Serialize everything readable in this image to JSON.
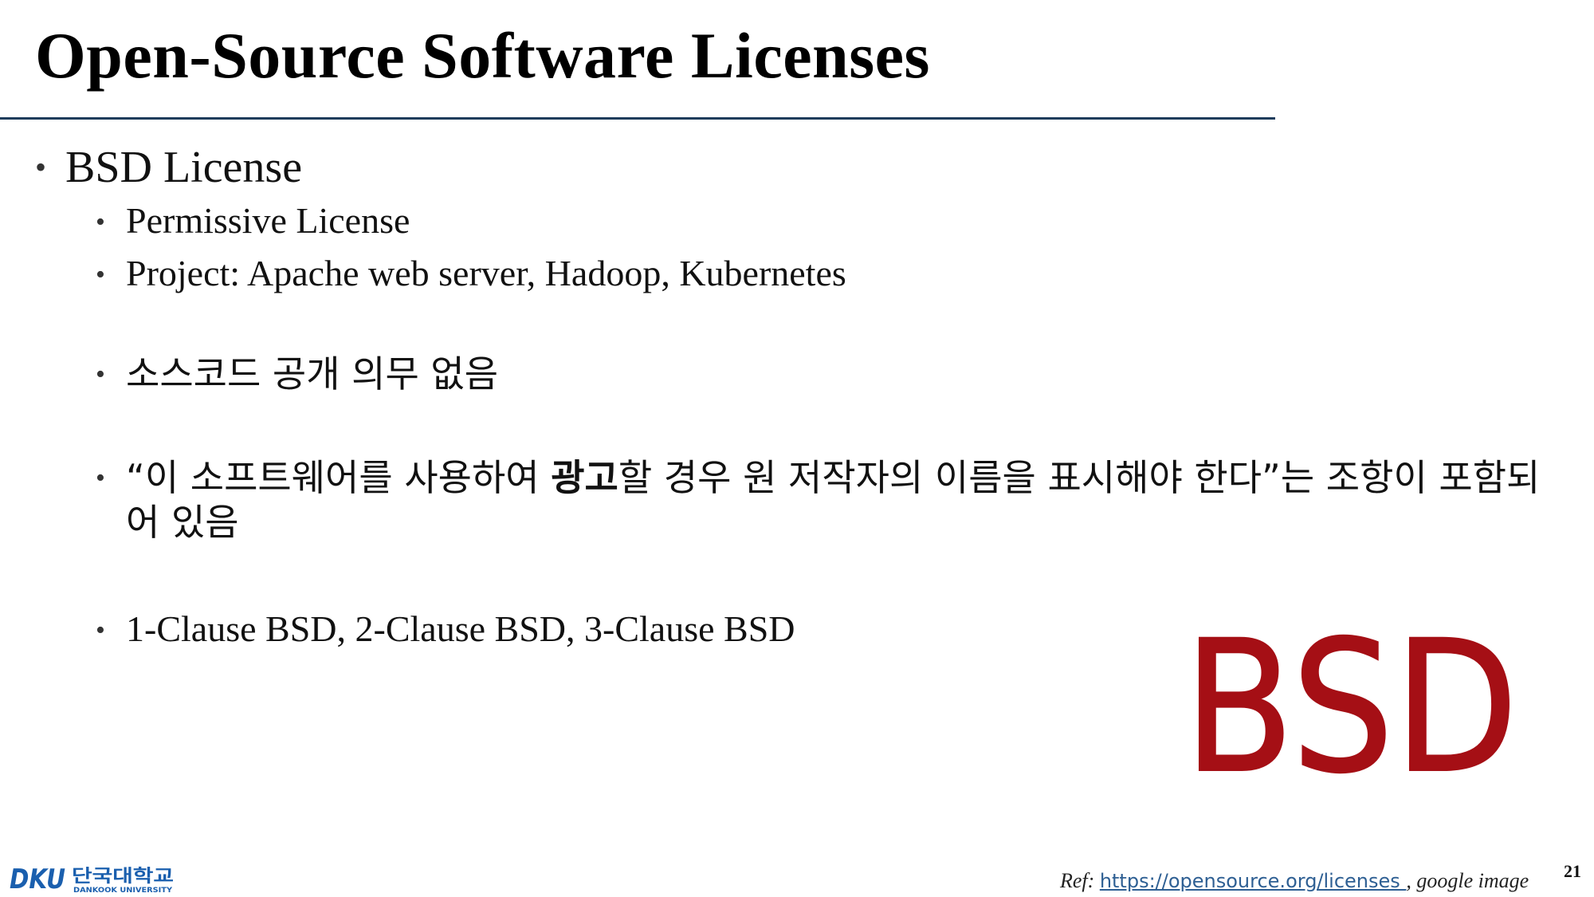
{
  "slide": {
    "title": "Open-Source Software Licenses",
    "bullets": {
      "main": "BSD License",
      "sub1": "Permissive License",
      "sub2": "Project: Apache web server, Hadoop, Kubernetes",
      "sub3": "소스코드 공개 의무 없음",
      "sub4": {
        "pre": "“이 소프트웨어를 사용하여 ",
        "bold": "광고",
        "post": "할 경우 원 저작자의 이름을 표시해야 한다”는 조항이 포함되어 있음"
      },
      "sub5": "1-Clause BSD, 2-Clause BSD, 3-Clause BSD"
    },
    "bullet_glyph": "•",
    "logo_text": "BSD",
    "logo_color": "#a50f15",
    "ref": {
      "label": "Ref:",
      "url": "https://opensource.org/licenses ",
      "separator": ",",
      "suffix": "google image"
    },
    "page_number": "21",
    "footer_logo": {
      "mark": "DKU",
      "korean": "단국대학교",
      "english": "DANKOOK UNIVERSITY",
      "color": "#1a5fae"
    }
  }
}
